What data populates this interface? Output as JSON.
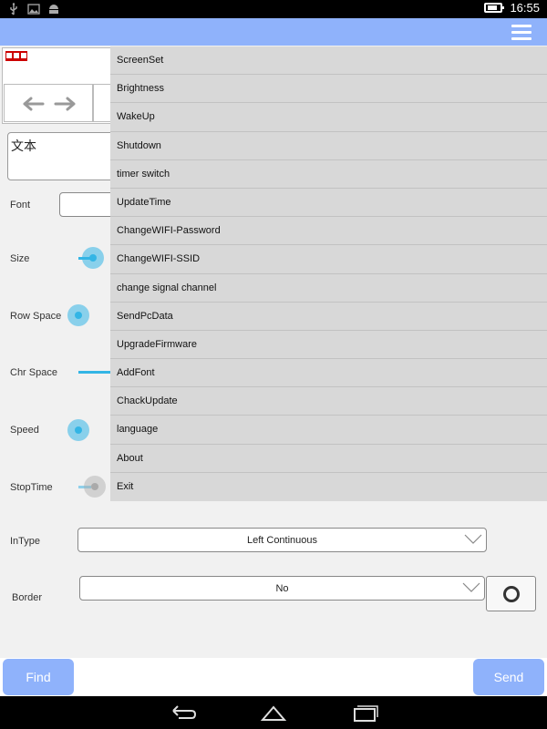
{
  "status_bar": {
    "time": "16:55",
    "icons": [
      "usb-icon",
      "image-icon",
      "android-icon",
      "battery-icon"
    ]
  },
  "app_bar": {
    "menu_icon": "hamburger-menu-icon",
    "color": "#8fb2fb"
  },
  "preview": {
    "text": "文本"
  },
  "form": {
    "font_label": "Font",
    "size_label": "Size",
    "size_value": 0.5,
    "row_space_label": "Row Space",
    "row_space_value": 0.0,
    "chr_space_label": "Chr Space",
    "chr_space_value": 1.0,
    "speed_label": "Speed",
    "speed_value": 0.0,
    "stoptime_label": "StopTime",
    "stoptime_value": 0.5,
    "intype_label": "InType",
    "intype_value": "Left Continuous",
    "border_label": "Border",
    "border_value": "No"
  },
  "buttons": {
    "find": "Find",
    "send": "Send"
  },
  "menu": {
    "items": [
      "ScreenSet",
      "Brightness",
      "WakeUp",
      "Shutdown",
      "timer switch",
      "UpdateTime",
      "ChangeWIFI-Password",
      "ChangeWIFI-SSID",
      "change signal channel",
      "SendPcData",
      "UpgradeFirmware",
      "AddFont",
      "ChackUpdate",
      "language",
      "About",
      "Exit"
    ]
  },
  "nav_bar": {
    "icons": [
      "back-icon",
      "home-icon",
      "recent-apps-icon"
    ]
  },
  "colors": {
    "accent": "#8fb2fb",
    "slider": "#33b5e5",
    "menu_bg": "#d8d8d8"
  }
}
